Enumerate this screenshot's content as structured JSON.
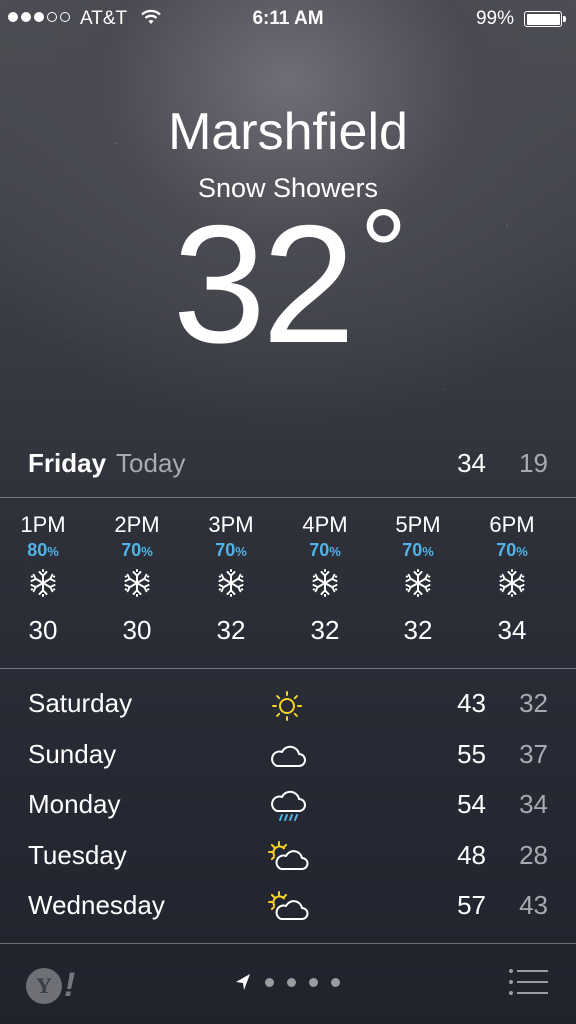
{
  "status_bar": {
    "carrier": "AT&T",
    "time": "6:11 AM",
    "battery": "99%",
    "signal_bars_filled": 3,
    "signal_bars_total": 5
  },
  "location": {
    "city": "Marshfield",
    "condition": "Snow Showers",
    "temperature": "32",
    "degree": "°"
  },
  "today": {
    "day": "Friday",
    "label": "Today",
    "high": "34",
    "low": "19"
  },
  "hourly": [
    {
      "hour": "1PM",
      "precip": "80",
      "unit": "%",
      "icon": "snowflake-icon",
      "temp": "30"
    },
    {
      "hour": "2PM",
      "precip": "70",
      "unit": "%",
      "icon": "snowflake-icon",
      "temp": "30"
    },
    {
      "hour": "3PM",
      "precip": "70",
      "unit": "%",
      "icon": "snowflake-icon",
      "temp": "32"
    },
    {
      "hour": "4PM",
      "precip": "70",
      "unit": "%",
      "icon": "snowflake-icon",
      "temp": "32"
    },
    {
      "hour": "5PM",
      "precip": "70",
      "unit": "%",
      "icon": "snowflake-icon",
      "temp": "32"
    },
    {
      "hour": "6PM",
      "precip": "70",
      "unit": "%",
      "icon": "snowflake-icon",
      "temp": "34"
    }
  ],
  "daily": [
    {
      "day": "Saturday",
      "icon": "sun-icon",
      "high": "43",
      "low": "32"
    },
    {
      "day": "Sunday",
      "icon": "cloud-icon",
      "high": "55",
      "low": "37"
    },
    {
      "day": "Monday",
      "icon": "rain-cloud-icon",
      "high": "54",
      "low": "34"
    },
    {
      "day": "Tuesday",
      "icon": "partly-cloudy-icon",
      "high": "48",
      "low": "28"
    },
    {
      "day": "Wednesday",
      "icon": "partly-cloudy-icon",
      "high": "57",
      "low": "43"
    }
  ],
  "bottom_bar": {
    "logo_letter": "Y",
    "logo_bang": "!",
    "page_count": 4
  },
  "colors": {
    "precip": "#51b3e8",
    "sun": "#f5d321",
    "secondary_text": "#a8aab2"
  }
}
